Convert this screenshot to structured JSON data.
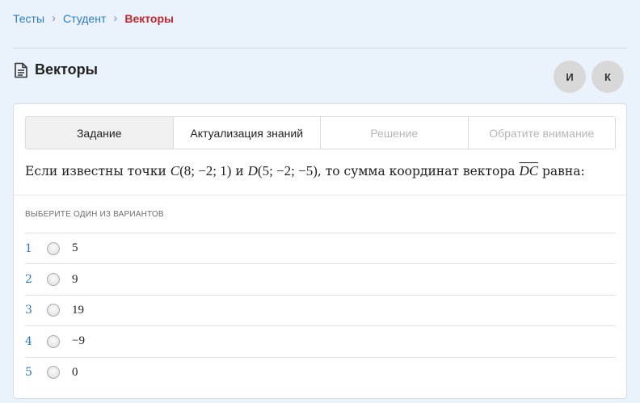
{
  "breadcrumb": {
    "items": [
      "Тесты",
      "Студент",
      "Векторы"
    ],
    "separator": "›"
  },
  "header": {
    "title": "Векторы",
    "icon": "document-icon",
    "avatars": [
      "И",
      "К"
    ]
  },
  "tabs": [
    {
      "label": "Задание",
      "state": "active"
    },
    {
      "label": "Актуализация знаний",
      "state": "enabled"
    },
    {
      "label": "Решение",
      "state": "disabled"
    },
    {
      "label": "Обратите внимание",
      "state": "disabled"
    }
  ],
  "question": {
    "text_1": "Если известны точки ",
    "point_c_name": "C",
    "point_c_coords": "(8; −2; 1)",
    "text_2": " и ",
    "point_d_name": "D",
    "point_d_coords": "(5; −2; −5)",
    "text_3": ", то сумма координат вектора ",
    "vector": "DC",
    "text_4": " равна:"
  },
  "instruction": "ВЫБЕРИТЕ ОДИН ИЗ ВАРИАНТОВ",
  "answers": [
    {
      "number": "1",
      "value": "5"
    },
    {
      "number": "2",
      "value": "9"
    },
    {
      "number": "3",
      "value": "19"
    },
    {
      "number": "4",
      "value": "−9"
    },
    {
      "number": "5",
      "value": "0"
    }
  ],
  "colors": {
    "background": "#eaf3fb",
    "link": "#2e7bbf",
    "current_crumb": "#c0262d",
    "active_tab": "#f0f0f0",
    "disabled_text": "#b6b6b6"
  }
}
